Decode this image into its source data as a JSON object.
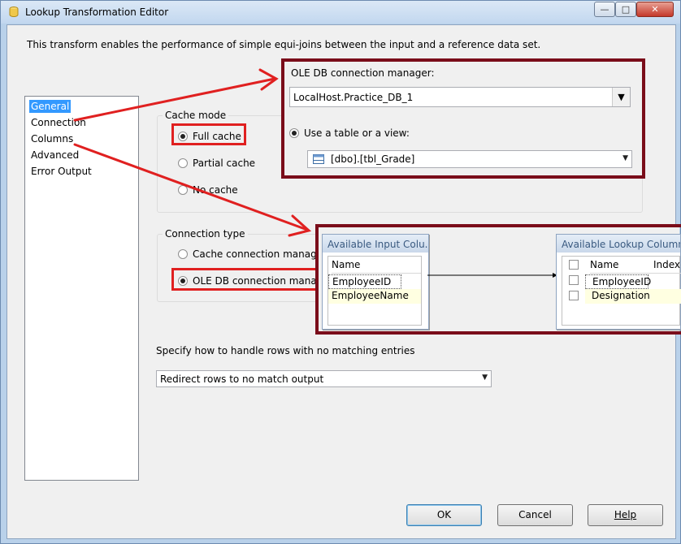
{
  "window": {
    "title": "Lookup Transformation Editor",
    "min_glyph": "—",
    "max_glyph": "□",
    "close_glyph": "✕"
  },
  "description": "This transform enables the performance of simple equi-joins between the input and a reference data set.",
  "nav": {
    "items": [
      {
        "label": "General",
        "selected": true
      },
      {
        "label": "Connection"
      },
      {
        "label": "Columns"
      },
      {
        "label": "Advanced"
      },
      {
        "label": "Error Output"
      }
    ]
  },
  "cache_mode": {
    "title": "Cache mode",
    "options": [
      {
        "label": "Full cache",
        "selected": true
      },
      {
        "label": "Partial cache",
        "selected": false
      },
      {
        "label": "No cache",
        "selected": false
      }
    ]
  },
  "connection_type": {
    "title": "Connection type",
    "options": [
      {
        "label": "Cache connection manager",
        "selected": false
      },
      {
        "label": "OLE DB connection manager",
        "selected": true
      }
    ]
  },
  "ole_db": {
    "label": "OLE DB connection manager:",
    "connection_value": "LocalHost.Practice_DB_1",
    "use_table_label": "Use a table or a view:",
    "table_value": "[dbo].[tbl_Grade]"
  },
  "columns": {
    "input_title": "Available Input Colu...",
    "input_header": "Name",
    "input_rows": [
      "EmployeeID",
      "EmployeeName"
    ],
    "lookup_title": "Available Lookup Columns",
    "lookup_headers": [
      "Name",
      "Index"
    ],
    "lookup_rows": [
      "EmployeeID",
      "Designation"
    ]
  },
  "no_match": {
    "label": "Specify how to handle rows with no matching entries",
    "value": "Redirect rows to no match output"
  },
  "buttons": {
    "ok": "OK",
    "cancel": "Cancel",
    "help": "Help"
  },
  "colors": {
    "annotation_red": "#e02020",
    "annotation_maroon": "#7a0d1a",
    "selection_blue": "#3399ff"
  }
}
